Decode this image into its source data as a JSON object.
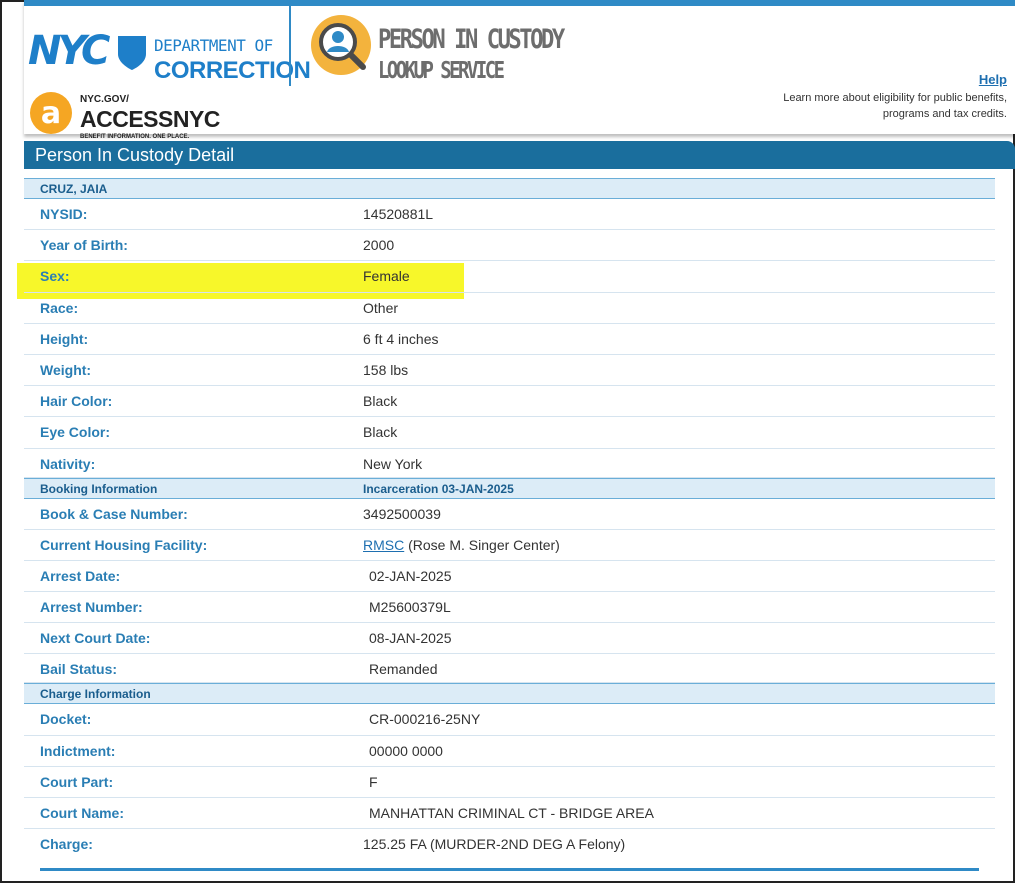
{
  "header": {
    "nyc_logo_text": "NYC",
    "department_line1": "DEPARTMENT OF",
    "department_line2": "CORRECTION",
    "service_title_line1": "PERSON IN CUSTODY",
    "service_title_line2": "LOOKUP SERVICE",
    "access_line1": "NYC.GOV/",
    "access_line2": "ACCESSNYC",
    "access_line3": "BENEFIT INFORMATION. ONE PLACE.",
    "help_link": "Help",
    "help_description": "Learn more about eligibility for public benefits, programs and tax credits."
  },
  "page_title": "Person In Custody Detail",
  "person_name": "CRUZ, JAIA",
  "personal": [
    {
      "label": "NYSID:",
      "value": "14520881L"
    },
    {
      "label": "Year of Birth:",
      "value": "2000"
    },
    {
      "label": "Sex:",
      "value": "Female"
    },
    {
      "label": "Race:",
      "value": "Other"
    },
    {
      "label": "Height:",
      "value": "6 ft 4 inches"
    },
    {
      "label": "Weight:",
      "value": "158 lbs"
    },
    {
      "label": "Hair Color:",
      "value": "Black"
    },
    {
      "label": "Eye Color:",
      "value": "Black"
    },
    {
      "label": "Nativity:",
      "value": "New York"
    }
  ],
  "booking": {
    "section_label": "Booking Information",
    "section_value": "Incarceration 03-JAN-2025",
    "book_case_label": "Book & Case Number:",
    "book_case_value": "3492500039",
    "facility_label": "Current Housing Facility:",
    "facility_code": "RMSC",
    "facility_name": "(Rose M. Singer Center)",
    "arrest_date_label": "Arrest Date:",
    "arrest_date_value": "02-JAN-2025",
    "arrest_number_label": "Arrest Number:",
    "arrest_number_value": "M25600379L",
    "next_court_label": "Next Court Date:",
    "next_court_value": "08-JAN-2025",
    "bail_label": "Bail Status:",
    "bail_value": "Remanded"
  },
  "charge": {
    "section_label": "Charge Information",
    "rows": [
      {
        "label": "Docket:",
        "value": "CR-000216-25NY"
      },
      {
        "label": "Indictment:",
        "value": "00000 0000"
      },
      {
        "label": "Court Part:",
        "value": "F"
      },
      {
        "label": "Court Name:",
        "value": "MANHATTAN CRIMINAL CT - BRIDGE AREA"
      }
    ],
    "charge_label": "Charge:",
    "charge_value": "125.25 FA (MURDER-2ND DEG A Felony)"
  },
  "colors": {
    "brand_blue": "#1e7fc9",
    "title_bar": "#1a6e9d",
    "label_blue": "#2a7eb4",
    "highlight": "#f7f72a",
    "accent_orange": "#f39a1e"
  }
}
